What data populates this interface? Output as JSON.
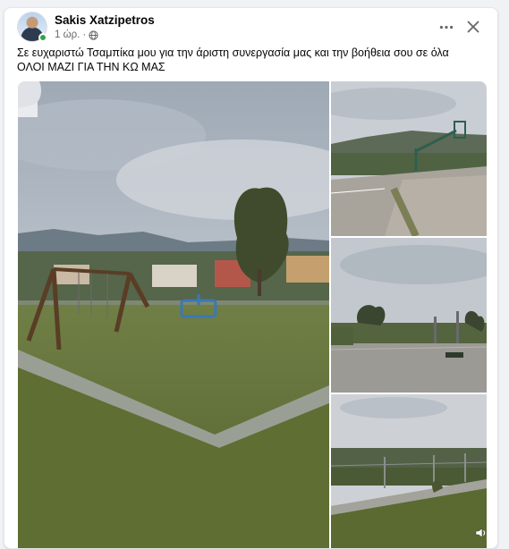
{
  "post": {
    "author": "Sakis Xatzipetros",
    "time": "1 ώρ.",
    "separator": "·",
    "icons": {
      "more": "more-options-icon",
      "close": "close-icon",
      "audience": "globe-icon",
      "sound": "volume-icon"
    },
    "text_line1": "Σε ευχαριστώ Τσαμπίκα μου για την άριστη συνεργασία μας και την βοήθεια σου σε όλα",
    "text_line2": "ΟΛΟΙ ΜΑΖΙ ΓΙΑ ΤΗΝ ΚΩ ΜΑΣ"
  },
  "colors": {
    "online": "#31a24c",
    "secondary_text": "#65676b",
    "card_bg": "#ffffff",
    "page_bg": "#f0f2f5"
  }
}
